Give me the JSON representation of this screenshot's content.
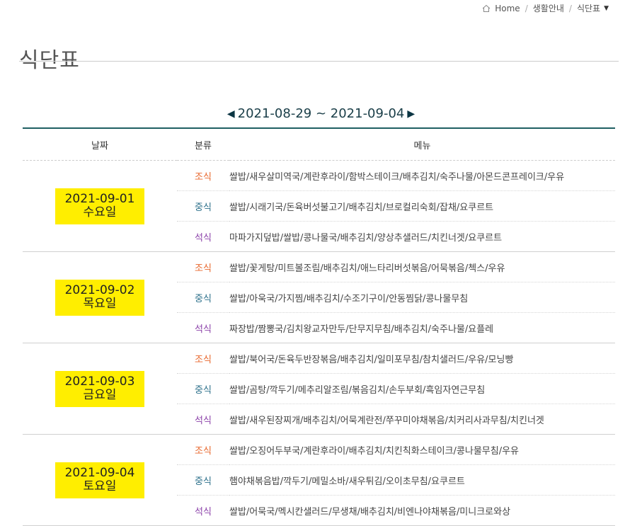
{
  "breadcrumb": {
    "items": [
      "Home",
      "생활안내",
      "식단표"
    ]
  },
  "page": {
    "title": "식단표"
  },
  "week": {
    "range": "2021-08-29 ~ 2021-09-04",
    "prev_icon": "◀",
    "next_icon": "▶"
  },
  "table": {
    "headers": [
      "날짜",
      "분류",
      "메뉴"
    ],
    "days": [
      {
        "date": "2021-09-01",
        "weekday": "수요일",
        "meals": [
          {
            "type": "조식",
            "items": "쌀밥/새우살미역국/계란후라이/함박스테이크/배추김치/숙주나물/아몬드콘프레이크/우유"
          },
          {
            "type": "중식",
            "items": "쌀밥/시래기국/돈육버섯불고기/배추김치/브로컬리숙회/잡채/요쿠르트"
          },
          {
            "type": "석식",
            "items": "마파가지덮밥/쌀밥/콩나물국/배추김치/양상추샐러드/치킨너겟/요쿠르트"
          }
        ]
      },
      {
        "date": "2021-09-02",
        "weekday": "목요일",
        "meals": [
          {
            "type": "조식",
            "items": "쌀밥/꽃게탕/미트볼조림/배추김치/애느타리버섯볶음/어묵볶음/첵스/우유"
          },
          {
            "type": "중식",
            "items": "쌀밥/아욱국/가지찜/배추김치/수조기구이/안동찜닭/콩나물무침"
          },
          {
            "type": "석식",
            "items": "짜장밥/짬뽕국/김치왕교자만두/단무지무침/배추김치/숙주나물/요플레"
          }
        ]
      },
      {
        "date": "2021-09-03",
        "weekday": "금요일",
        "meals": [
          {
            "type": "조식",
            "items": "쌀밥/북어국/돈육두반장볶음/배추김치/일미포무침/참치샐러드/우유/모닝빵"
          },
          {
            "type": "중식",
            "items": "쌀밥/곰탕/깍두기/메추리알조림/볶음김치/손두부회/흑임자연근무침"
          },
          {
            "type": "석식",
            "items": "쌀밥/새우된장찌개/배추김치/어묵계란전/쭈꾸미야채볶음/치커리사과무침/치킨너겟"
          }
        ]
      },
      {
        "date": "2021-09-04",
        "weekday": "토요일",
        "meals": [
          {
            "type": "조식",
            "items": "쌀밥/오징어두부국/계란후라이/배추김치/치킨칙화스테이크/콩나물무침/우유"
          },
          {
            "type": "중식",
            "items": "햄야채볶음밥/깍두기/메밀소바/새우튀김/오이초무침/요쿠르트"
          },
          {
            "type": "석식",
            "items": "쌀밥/어묵국/멕시칸샐러드/무생채/배추김치/비엔나야채볶음/미니크로와상"
          }
        ]
      }
    ]
  },
  "colors": {
    "breakfast": "#e8662b",
    "lunch": "#2b6f8a",
    "dinner": "#8a3fa8",
    "date_highlight": "#ffee00",
    "table_top_rule": "#1f5f63"
  }
}
